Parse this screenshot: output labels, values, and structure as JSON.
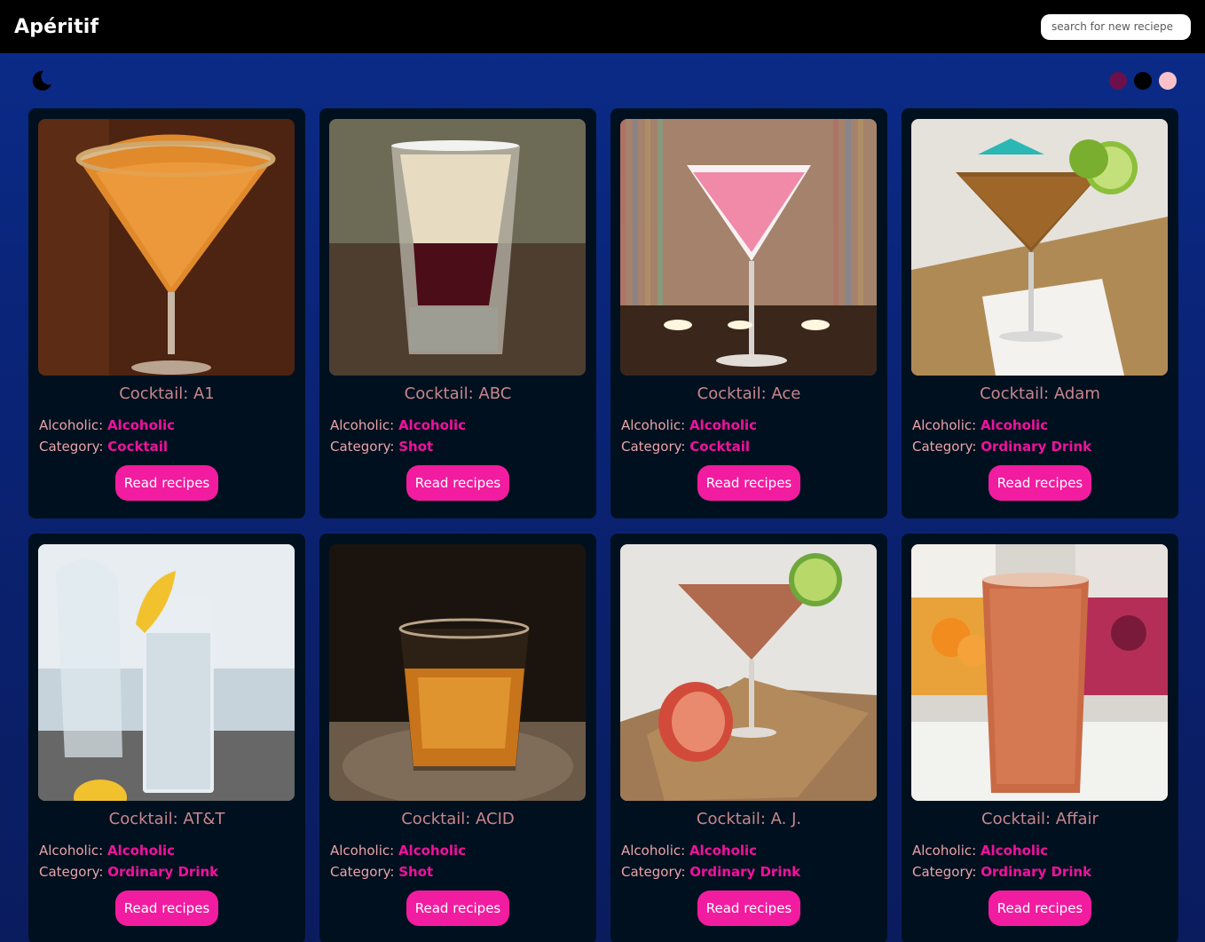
{
  "header": {
    "brand": "Apéritif",
    "search_placeholder": "search for new reciepe"
  },
  "controls": {
    "theme_icon": "moon-icon",
    "swatches": [
      {
        "name": "plum",
        "color": "#6b0f4d"
      },
      {
        "name": "black",
        "color": "#000000"
      },
      {
        "name": "pink",
        "color": "#f9c1ca"
      }
    ]
  },
  "labels": {
    "alcoholic_key": "Alcoholic: ",
    "category_key": "Category: ",
    "button": "Read recipes"
  },
  "cards": [
    {
      "title": "Cocktail: A1",
      "alcoholic": "Alcoholic",
      "category": "Cocktail",
      "image": "orange martini with sugared rim"
    },
    {
      "title": "Cocktail: ABC",
      "alcoholic": "Alcoholic",
      "category": "Shot",
      "image": "layered shot glass"
    },
    {
      "title": "Cocktail: Ace",
      "alcoholic": "Alcoholic",
      "category": "Cocktail",
      "image": "pink martini with candles"
    },
    {
      "title": "Cocktail: Adam",
      "alcoholic": "Alcoholic",
      "category": "Ordinary Drink",
      "image": "martini with umbrella and lime"
    },
    {
      "title": "Cocktail: AT&T",
      "alcoholic": "Alcoholic",
      "category": "Ordinary Drink",
      "image": "tall glass with ice and lemon"
    },
    {
      "title": "Cocktail: ACID",
      "alcoholic": "Alcoholic",
      "category": "Shot",
      "image": "whiskey on the rocks"
    },
    {
      "title": "Cocktail: A. J.",
      "alcoholic": "Alcoholic",
      "category": "Ordinary Drink",
      "image": "martini with grapefruit"
    },
    {
      "title": "Cocktail: Affair",
      "alcoholic": "Alcoholic",
      "category": "Ordinary Drink",
      "image": "juice cocktail with cartons"
    }
  ]
}
